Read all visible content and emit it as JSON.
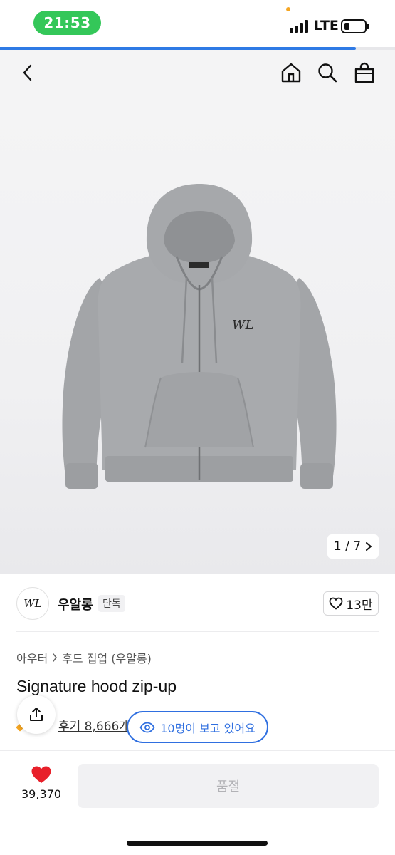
{
  "status_bar": {
    "time": "21:53",
    "network": "LTE",
    "battery_level": 0.25,
    "page_load_progress": 0.9
  },
  "nav": {
    "back_icon": "chevron-left-icon",
    "home_icon": "home-icon",
    "search_icon": "search-icon",
    "bag_icon": "shopping-bag-icon"
  },
  "gallery": {
    "counter": "1 / 7",
    "current": 1,
    "total": 7
  },
  "brand": {
    "logo_text": "WL",
    "name": "우알롱",
    "badge": "단독",
    "likes": "13만"
  },
  "product": {
    "breadcrumb": [
      "아우터",
      "후드 집업 (우알롱)"
    ],
    "title": "Signature hood zip-up",
    "reviews": "후기 8,666개",
    "viewers": "10명이 보고 있어요"
  },
  "bottom_bar": {
    "wish_count": "39,370",
    "buy_label": "품절"
  },
  "colors": {
    "status_pill": "#34c759",
    "accent_blue": "#2f6fe0",
    "heart_red": "#e8202a",
    "hoodie_gray": "#a3a5a8"
  }
}
